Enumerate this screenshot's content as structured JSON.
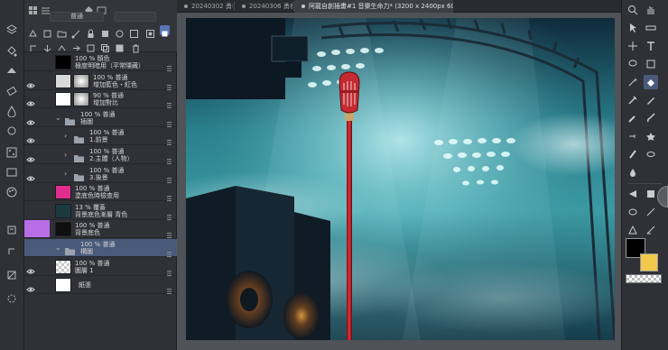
{
  "tabs": [
    {
      "label": "20240302 勇者...",
      "active": false
    },
    {
      "label": "20240306 勇者...",
      "active": false
    },
    {
      "label": "阿龍自創插畫#1 音樂生命力* (3200 x 2400px 600dpi 47.9%)",
      "active": true
    }
  ],
  "layer_panel": {
    "blend_mode": "普通"
  },
  "layers": [
    {
      "line1": "100 % 顏色",
      "line2": "極度明暗用（平常隱藏）",
      "visible": false,
      "kind": "raster",
      "thumb": "#000000"
    },
    {
      "line1": "100 % 普通",
      "line2": "增加藍色・紅色",
      "visible": true,
      "kind": "masked",
      "thumb": "#d9d9d9"
    },
    {
      "line1": "90 % 普通",
      "line2": "增加對比",
      "visible": true,
      "kind": "masked",
      "thumb": "#ffffff"
    },
    {
      "line1": "100 % 普通",
      "line2": "插圖",
      "visible": true,
      "kind": "folder"
    },
    {
      "line1": "100 % 普通",
      "line2": "1.前景",
      "visible": true,
      "kind": "folder",
      "indent": 1
    },
    {
      "line1": "100 % 普通",
      "line2": "2.主體（人物）",
      "visible": true,
      "kind": "folder",
      "indent": 1
    },
    {
      "line1": "100 % 普通",
      "line2": "3.後景",
      "visible": true,
      "kind": "folder",
      "indent": 1
    },
    {
      "line1": "100 % 普通",
      "line2": "塗底色時檢查用",
      "visible": false,
      "kind": "raster",
      "thumb": "#e02d8f"
    },
    {
      "line1": "13 % 覆蓋",
      "line2": "背景底色漸層 青色",
      "visible": false,
      "kind": "raster",
      "thumb": "#1a3a40"
    },
    {
      "line1": "100 % 普通",
      "line2": "背景底色",
      "visible": false,
      "kind": "raster",
      "thumb": "#0f0f0f",
      "tagged": true
    },
    {
      "line1": "100 % 普通",
      "line2": "構圖",
      "visible": false,
      "kind": "folder",
      "selected": true
    },
    {
      "line1": "100 % 普通",
      "line2": "圖層 1",
      "visible": true,
      "kind": "raster",
      "thumb": "checker"
    },
    {
      "line1": "",
      "line2": "紙張",
      "visible": true,
      "kind": "paper",
      "thumb": "#ffffff"
    }
  ],
  "colors": {
    "accent_select": "#4a5a7a",
    "main_color": "#000000",
    "sub_color": "#f2c94c",
    "tag_purple": "#b86ee6"
  }
}
